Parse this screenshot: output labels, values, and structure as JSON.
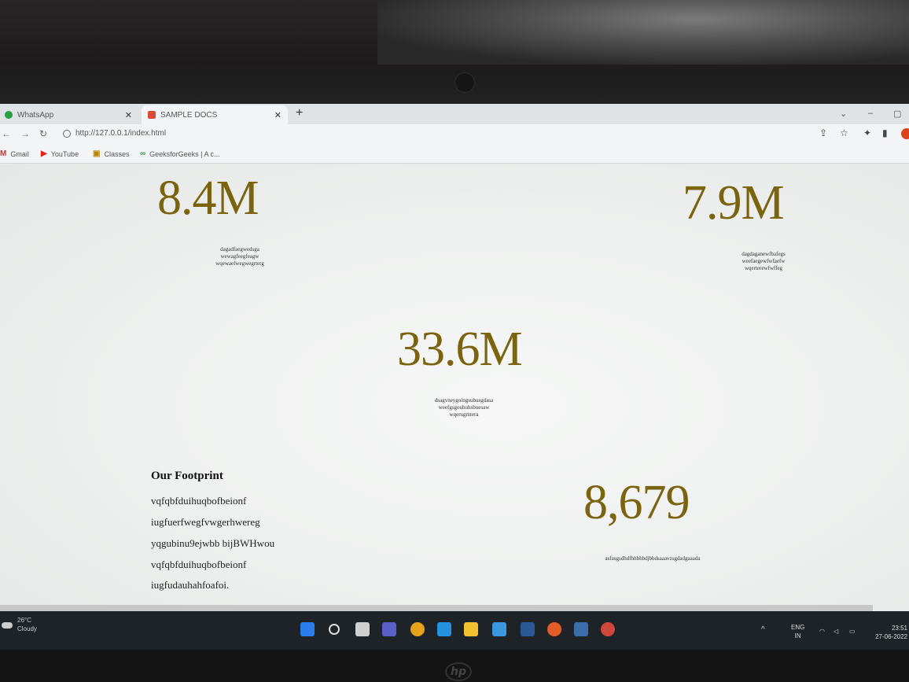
{
  "browser": {
    "tabs": [
      {
        "label": "WhatsApp",
        "active": false
      },
      {
        "label": "SAMPLE DOCS",
        "active": true
      }
    ],
    "url": "http://127.0.0.1/index.html",
    "bookmarks": [
      {
        "label": "Gmail",
        "icon": "gmail-icon"
      },
      {
        "label": "YouTube",
        "icon": "youtube-icon"
      },
      {
        "label": "Classes",
        "icon": "classes-icon"
      },
      {
        "label": "GeeksforGeeks | A c...",
        "icon": "geeksforgeeks-icon"
      }
    ]
  },
  "stats": [
    {
      "value": "8.4M",
      "desc": [
        "dagadfaegwedsga",
        "wewagfeegfeagw",
        "wqewaefwegwegrterg"
      ]
    },
    {
      "value": "7.9M",
      "desc": [
        "dagdaganewfbafegs",
        "weefaegewfwfaefw",
        "wqerterewfwffeg"
      ]
    },
    {
      "value": "33.6M",
      "desc": [
        "dsagvneygoingsubusgdasa",
        "weefgsgouhuhsbuesaw",
        "wqerugmtera"
      ]
    },
    {
      "value": "8,679",
      "desc": [
        "asfasgsdhdfhhbhbdjbbdsaaavzsgdadgaaada"
      ]
    }
  ],
  "footprint": {
    "title": "Our Footprint",
    "lines": [
      "vqfqbfduihuqbofbeionf",
      "iugfuerfwegfvwgerhwereg",
      "yqgubinu9ejwbb bijBWHwou",
      "vqfqbfduihuqbofbeionf",
      "iugfudauhahfoafoi."
    ]
  },
  "taskbar": {
    "weather_temp": "26°C",
    "weather_text": "Cloudy",
    "lang_top": "ENG",
    "lang_bottom": "IN",
    "time": "23:51",
    "date": "27-06-2022"
  },
  "colors": {
    "stat_gold": "#7a6410",
    "taskbar": "#1e2327"
  }
}
